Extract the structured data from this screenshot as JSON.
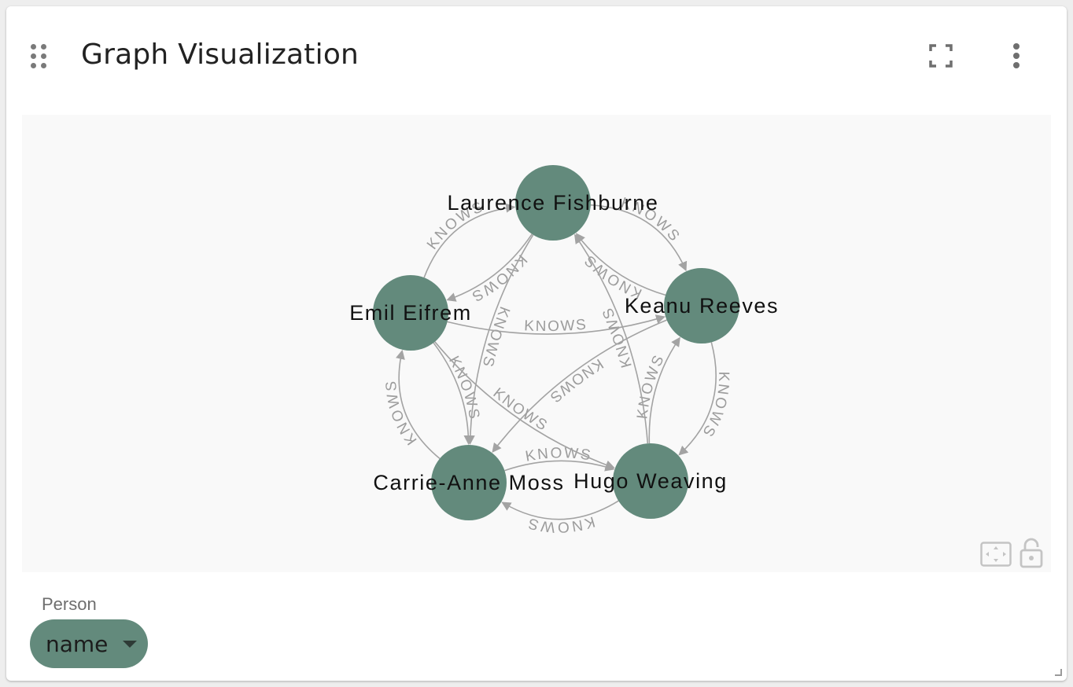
{
  "card": {
    "title": "Graph Visualization",
    "icons": {
      "drag": "drag-handle-icon",
      "fullscreen": "fullscreen-icon",
      "menu": "more-vert-icon",
      "fit": "fit-to-screen-icon",
      "lock": "lock-open-icon",
      "resize": "resize-corner-icon"
    }
  },
  "graph": {
    "node_color": "#638a7c",
    "edge_color": "#a3a3a3",
    "nodes": [
      {
        "id": "lf",
        "label": "Laurence Fishburne"
      },
      {
        "id": "kr",
        "label": "Keanu Reeves"
      },
      {
        "id": "hw",
        "label": "Hugo Weaving"
      },
      {
        "id": "cam",
        "label": "Carrie-Anne Moss"
      },
      {
        "id": "ee",
        "label": "Emil Eifrem"
      }
    ],
    "edges": [
      {
        "from": "lf",
        "to": "ee",
        "label": "KNOWS"
      },
      {
        "from": "ee",
        "to": "lf",
        "label": "KNOWS"
      },
      {
        "from": "kr",
        "to": "lf",
        "label": "KNOWS"
      },
      {
        "from": "lf",
        "to": "kr",
        "label": "KNOWS"
      },
      {
        "from": "hw",
        "to": "kr",
        "label": "KNOWS"
      },
      {
        "from": "kr",
        "to": "hw",
        "label": "KNOWS"
      },
      {
        "from": "cam",
        "to": "hw",
        "label": "KNOWS"
      },
      {
        "from": "hw",
        "to": "cam",
        "label": "KNOWS"
      },
      {
        "from": "ee",
        "to": "cam",
        "label": "KNOWS"
      },
      {
        "from": "cam",
        "to": "ee",
        "label": "KNOWS"
      },
      {
        "from": "lf",
        "to": "cam",
        "label": "KNOWS"
      },
      {
        "from": "hw",
        "to": "lf",
        "label": "KNOWS"
      },
      {
        "from": "ee",
        "to": "kr",
        "label": "KNOWS"
      },
      {
        "from": "kr",
        "to": "cam",
        "label": "KNOWS"
      },
      {
        "from": "ee",
        "to": "hw",
        "label": "KNOWS"
      }
    ]
  },
  "legend": {
    "label": "Person",
    "property": "name"
  }
}
